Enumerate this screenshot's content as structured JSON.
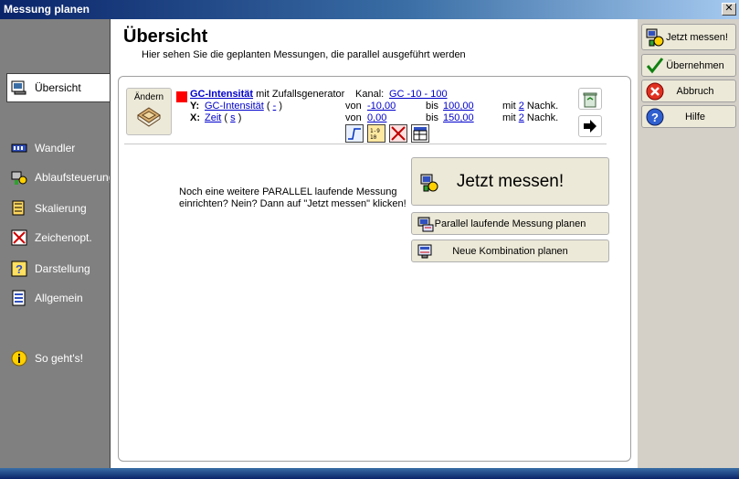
{
  "window": {
    "title": "Messung planen",
    "close_label": "✕"
  },
  "sidebar": {
    "items": [
      {
        "label": "Übersicht"
      },
      {
        "label": "Wandler"
      },
      {
        "label": "Ablaufsteuerung"
      },
      {
        "label": "Skalierung"
      },
      {
        "label": "Zeichenopt."
      },
      {
        "label": "Darstellung"
      },
      {
        "label": "Allgemein"
      },
      {
        "label": "So geht's!"
      }
    ]
  },
  "main": {
    "title": "Übersicht",
    "subtitle": "Hier sehen Sie die geplanten Messungen, die parallel ausgeführt werden",
    "measurement": {
      "aendern_label": "Ändern",
      "name": "GC-Intensität",
      "generator_text": "mit Zufallsgenerator",
      "kanal_label": "Kanal:",
      "kanal_value": "GC -10 - 100",
      "y_label": "Y:",
      "y_name": "GC-Intensität",
      "y_paren_open": "(",
      "y_unit": "-",
      "y_paren_close": ")",
      "y_von_label": "von",
      "y_von": "-10,00",
      "y_bis_label": "bis",
      "y_bis": "100,00",
      "y_mit_label": "mit",
      "y_nachk": "2",
      "y_nachk_label": "Nachk.",
      "x_label": "X:",
      "x_name": "Zeit",
      "x_paren_open": "(",
      "x_unit": "s",
      "x_paren_close": ")",
      "x_von_label": "von",
      "x_von": "0,00",
      "x_bis_label": "bis",
      "x_bis": "150,00",
      "x_mit_label": "mit",
      "x_nachk": "2",
      "x_nachk_label": "Nachk."
    },
    "info_text": "Noch eine weitere PARALLEL laufende Messung einrichten? Nein? Dann auf \"Jetzt messen\" klicken!",
    "jetzt_messen_big": "Jetzt messen!",
    "parallel_button": "Parallel laufende Messung planen",
    "kombination_button": "Neue Kombination planen"
  },
  "rightbar": {
    "jetzt_messen": "Jetzt messen!",
    "uebernehmen": "Übernehmen",
    "abbruch": "Abbruch",
    "hilfe": "Hilfe"
  }
}
